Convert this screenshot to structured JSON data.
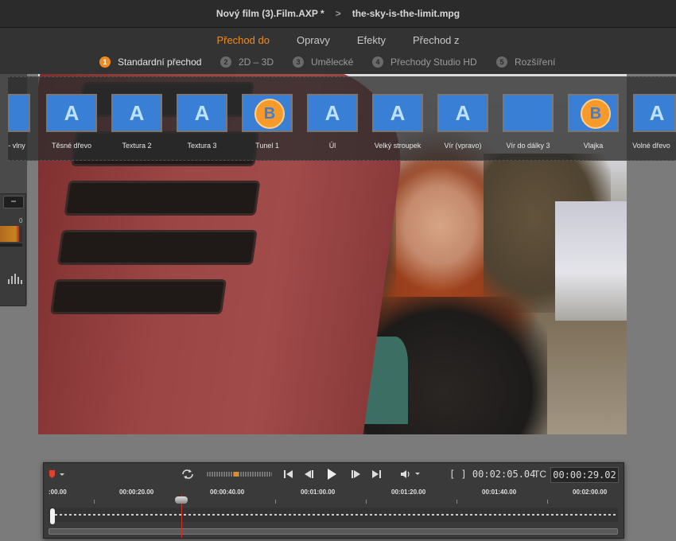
{
  "titlebar": {
    "project": "Nový film (3).Film.AXP *",
    "separator": ">",
    "clip": "the-sky-is-the-limit.mpg"
  },
  "tabs": [
    {
      "label": "Přechod do",
      "active": true
    },
    {
      "label": "Opravy",
      "active": false
    },
    {
      "label": "Efekty",
      "active": false
    },
    {
      "label": "Přechod z",
      "active": false
    }
  ],
  "subtabs": [
    {
      "num": "1",
      "label": "Standardní přechod",
      "active": true
    },
    {
      "num": "2",
      "label": "2D – 3D",
      "active": false
    },
    {
      "num": "3",
      "label": "Umělecké",
      "active": false
    },
    {
      "num": "4",
      "label": "Přechody Studio HD",
      "active": false
    },
    {
      "num": "5",
      "label": "Rozšíření",
      "active": false
    }
  ],
  "transitions": [
    {
      "label": "- vlny",
      "glyph": "",
      "pattern": "pat-wave"
    },
    {
      "label": "Těsné dřevo",
      "glyph": "A",
      "pattern": "pat-wood"
    },
    {
      "label": "Textura 2",
      "glyph": "A",
      "pattern": "pat-tex"
    },
    {
      "label": "Textura 3",
      "glyph": "A",
      "pattern": "pat-tex"
    },
    {
      "label": "Tunel 1",
      "glyph": "B",
      "pattern": "b-orange"
    },
    {
      "label": "Úl",
      "glyph": "A",
      "pattern": "pat-ui"
    },
    {
      "label": "Velký stroupek",
      "glyph": "A",
      "pattern": "pat-big"
    },
    {
      "label": "Vír (vpravo)",
      "glyph": "A",
      "pattern": "pat-wave"
    },
    {
      "label": "Vír do dálky 3",
      "glyph": "",
      "pattern": "pat-swirl"
    },
    {
      "label": "Vlajka",
      "glyph": "B",
      "pattern": "pat-wave"
    },
    {
      "label": "Volné dřevo",
      "glyph": "A",
      "pattern": "pat-wood"
    }
  ],
  "audio": {
    "meter_zero": "0"
  },
  "player": {
    "duration_label": "[ ] 00:02:05.04",
    "tc_label": "TC",
    "timecode": "00:00:29.02",
    "ruler": [
      ":00.00",
      "00:00:20.00",
      "00:00:40.00",
      "00:01:00.00",
      "00:01:20.00",
      "00:01:40.00",
      "00:02:00.00"
    ]
  },
  "colors": {
    "accent": "#f28a1e",
    "playhead": "#d42b2b"
  }
}
